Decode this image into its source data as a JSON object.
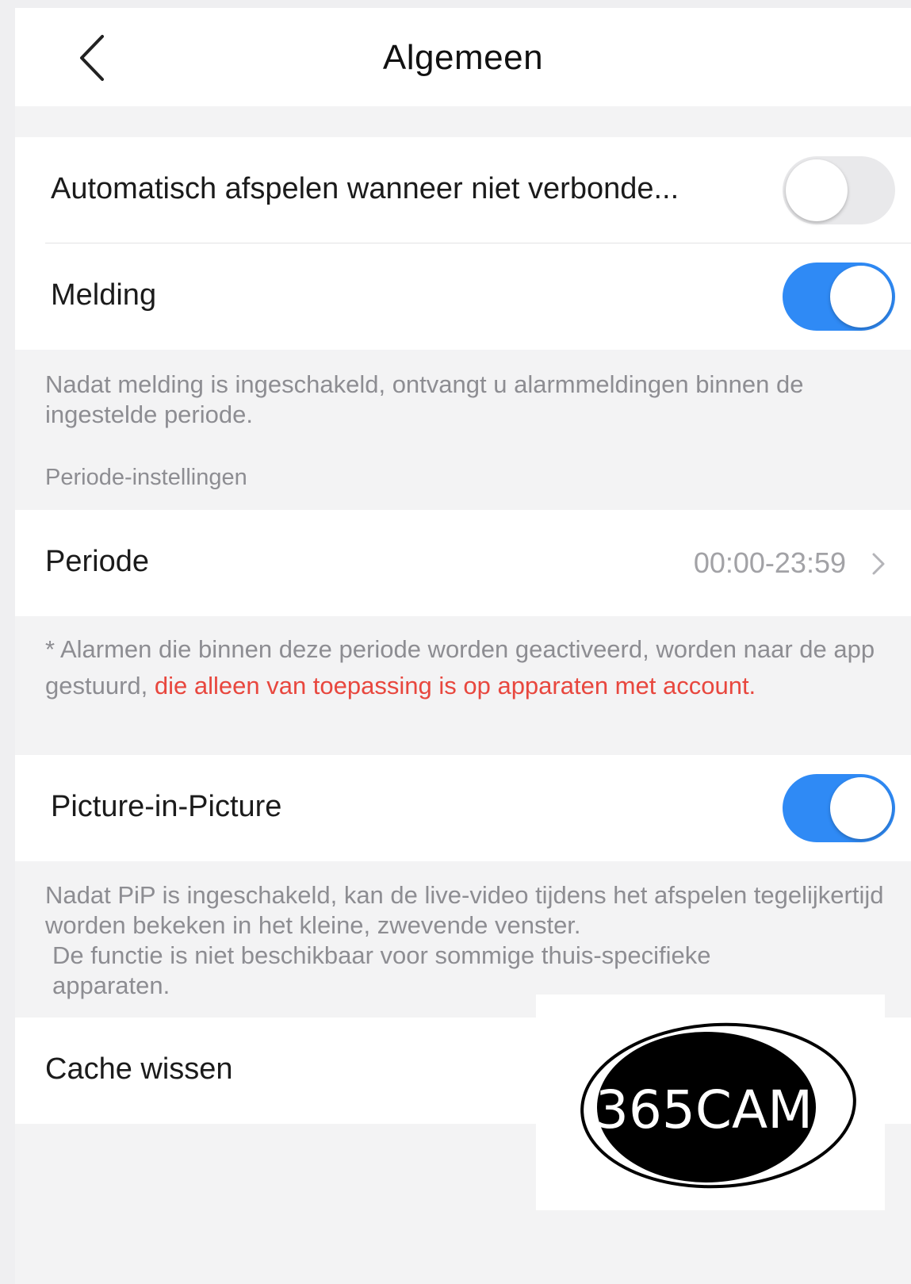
{
  "header": {
    "title": "Algemeen",
    "back_icon": "chevron-left-icon"
  },
  "settings": {
    "autoplay": {
      "label": "Automatisch afspelen wanneer niet verbonde...",
      "enabled": false
    },
    "notification": {
      "label": "Melding",
      "enabled": true,
      "help": "Nadat melding is ingeschakeld, ontvangt u alarmmeldingen binnen de ingestelde periode."
    },
    "period_section": {
      "header": "Periode-instellingen",
      "label": "Periode",
      "value": "00:00-23:59",
      "note_normal": "* Alarmen die binnen deze periode worden geactiveerd, worden naar de app gestuurd, ",
      "note_warning": "die alleen van toepassing is op apparaten met account."
    },
    "pip": {
      "label": "Picture-in-Picture",
      "enabled": true,
      "help_line1": "Nadat PiP is ingeschakeld, kan de live-video tijdens het afspelen tegelijkertijd worden bekeken in het kleine, zwevende venster.",
      "help_line2": "De functie is niet beschikbaar voor sommige thuis-specifieke apparaten."
    },
    "cache": {
      "label": "Cache wissen"
    }
  },
  "watermark": {
    "text": "365CAM"
  },
  "colors": {
    "accent": "#2f8af5",
    "warning": "#e8473e",
    "background": "#f3f3f4",
    "secondary_text": "#8d8d92"
  }
}
